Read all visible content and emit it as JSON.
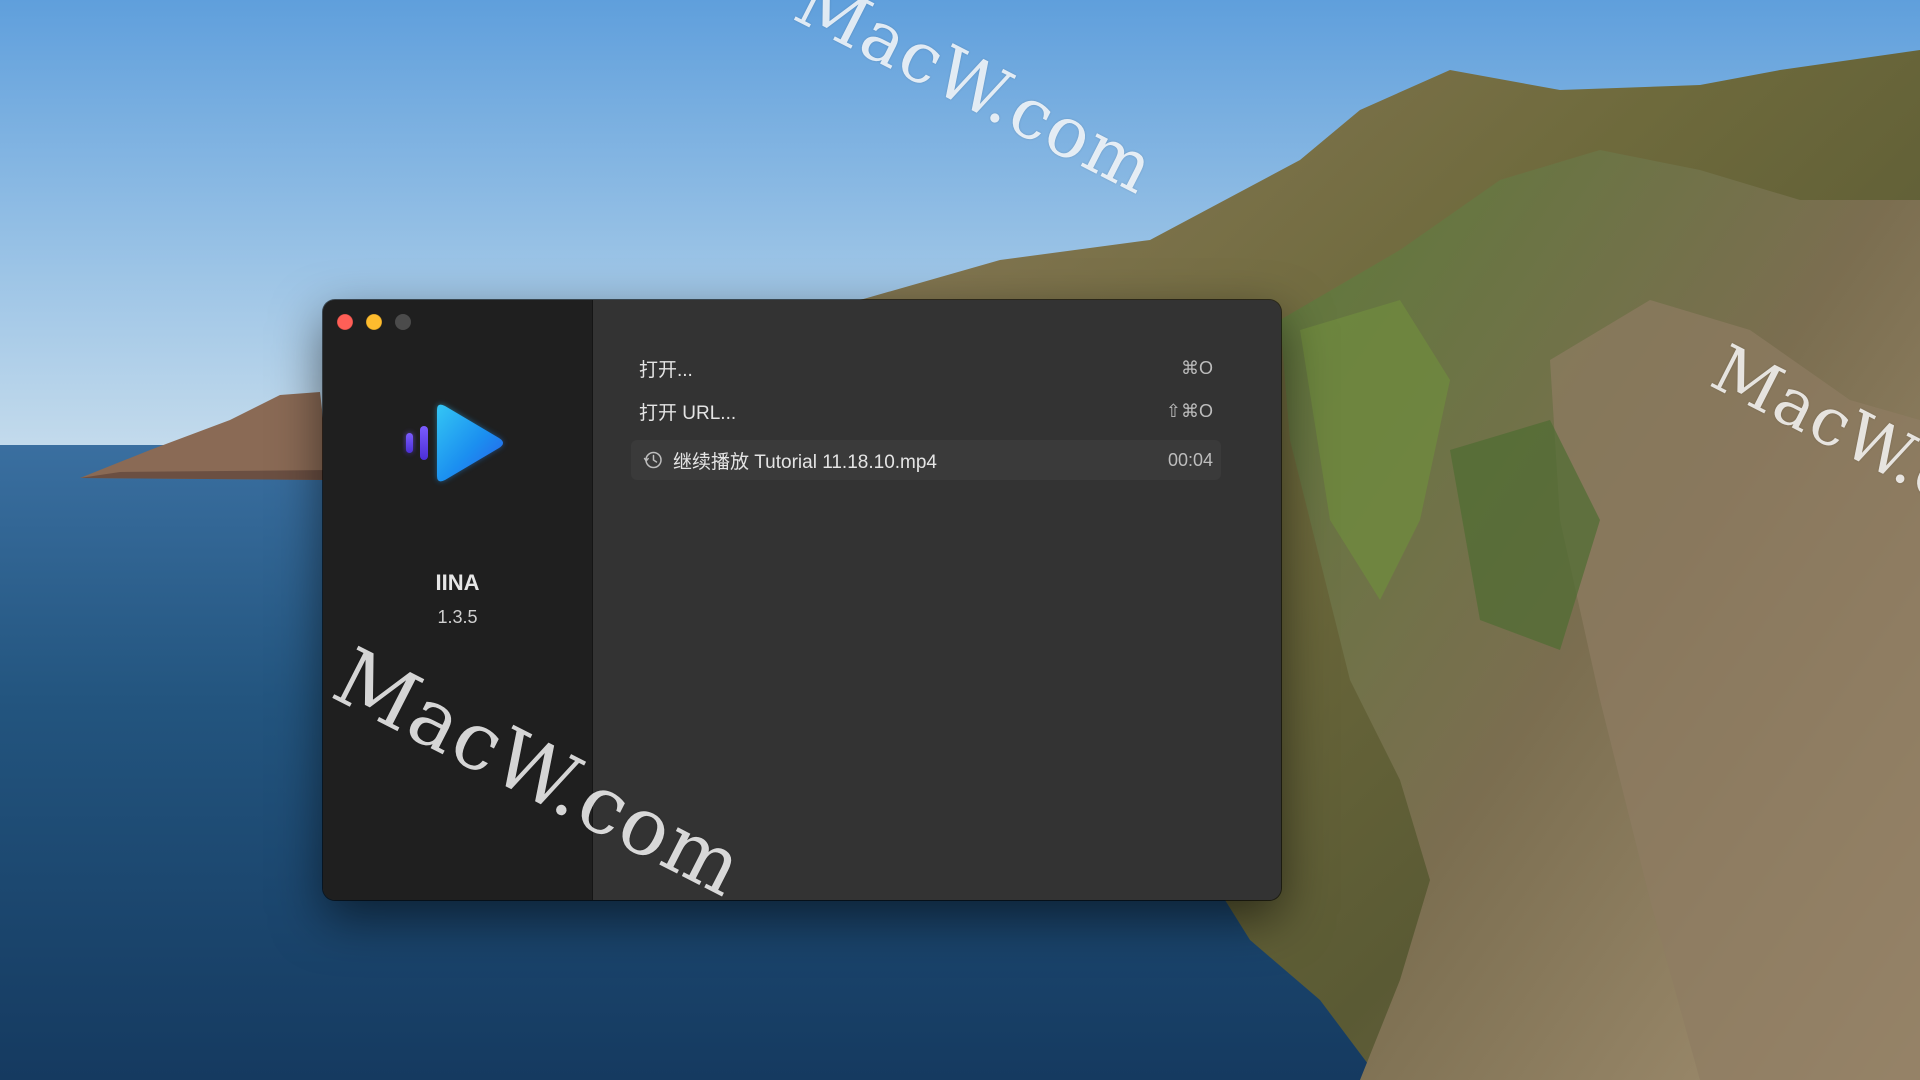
{
  "window": {
    "app_name": "IINA",
    "app_version": "1.3.5",
    "traffic_lights": {
      "close_color": "#ff5f57",
      "minimize_color": "#febc2e",
      "zoom_color": "#4b4b4b"
    }
  },
  "menu": {
    "open": {
      "label": "打开...",
      "shortcut": "⌘O"
    },
    "open_url": {
      "label": "打开 URL...",
      "shortcut": "⇧⌘O"
    },
    "resume": {
      "label": "继续播放 Tutorial 11.18.10.mp4",
      "time": "00:04",
      "icon": "history-icon"
    }
  },
  "watermark": {
    "text": "MacW.com"
  },
  "icons": {
    "logo": "iina-play-logo"
  }
}
